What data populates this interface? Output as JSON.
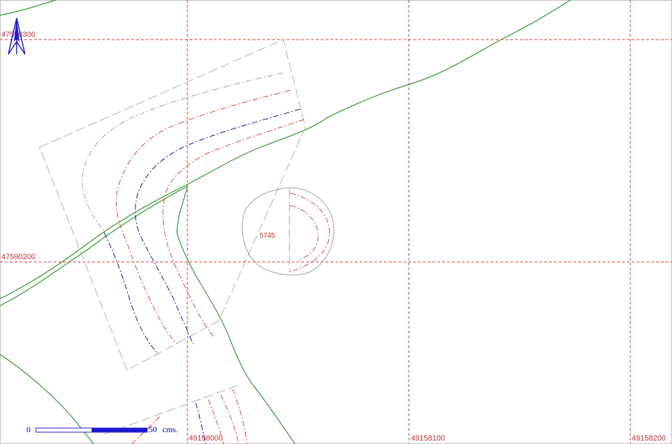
{
  "grid": {
    "easting_labels": [
      "49158000",
      "49158100",
      "49158200"
    ],
    "northing_labels": [
      "47590300",
      "47590200"
    ],
    "line_color": "#d83030"
  },
  "feature": {
    "label": "5745"
  },
  "north_arrow": {
    "icon": "north-arrow-icon",
    "color": "#1a1ad0"
  },
  "scale_bar": {
    "start_label": "0",
    "end_label": "50",
    "unit_label": "cms.",
    "color": "#1a1ad0"
  },
  "colors": {
    "terrain_line": "#2a9a2a",
    "contour_red": "#e04040",
    "contour_blue": "#1010a0",
    "contour_grey": "#a0a0a0",
    "boundary_grey": "#b0b0b0"
  }
}
